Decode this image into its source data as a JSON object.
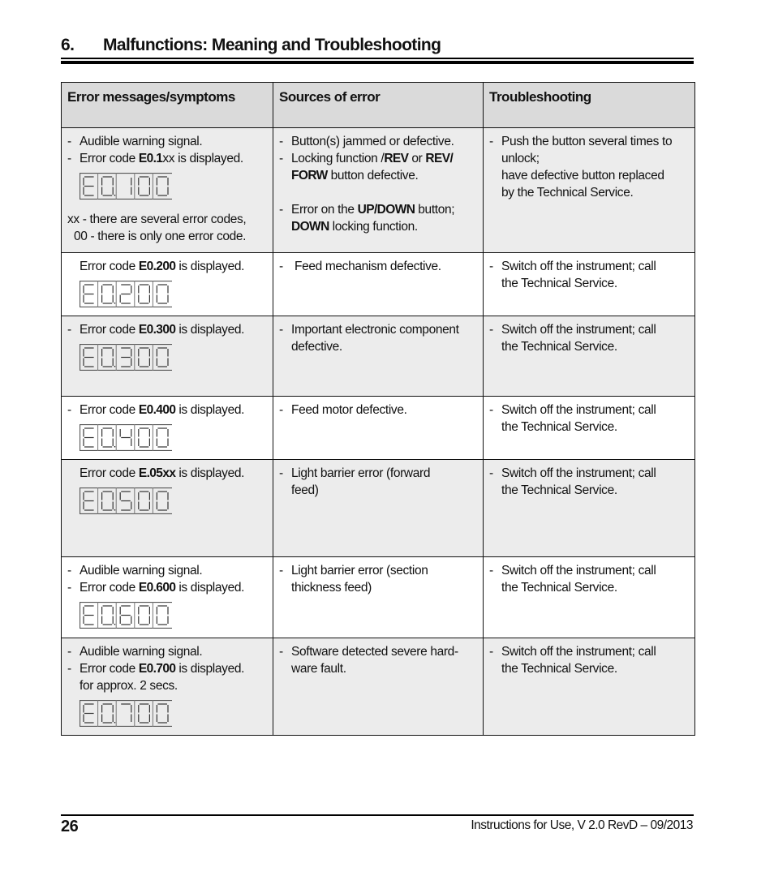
{
  "section": {
    "number": "6.",
    "title": "Malfunctions: Meaning and Troubleshooting"
  },
  "table": {
    "headers": [
      "Error messages/symptoms",
      "Sources of error",
      "Troubleshooting"
    ],
    "rows": [
      {
        "shade": "gray",
        "symptoms": [
          {
            "dash": true,
            "parts": [
              {
                "t": "Audible warning signal."
              }
            ]
          },
          {
            "dash": true,
            "parts": [
              {
                "t": "Error code "
              },
              {
                "t": "E0.1",
                "b": true
              },
              {
                "t": "xx is displayed."
              }
            ]
          }
        ],
        "display": {
          "digits": [
            "E",
            "0",
            "1",
            "0",
            "0"
          ],
          "dot_after": 1
        },
        "notes": [
          {
            "dash": false,
            "indent": false,
            "parts": [
              {
                "t": "xx - there are several error codes,"
              }
            ]
          },
          {
            "dash": false,
            "indent": "small",
            "parts": [
              {
                "t": "00 - there is only one error code."
              }
            ]
          }
        ],
        "sources": [
          {
            "dash": true,
            "parts": [
              {
                "t": "Button(s) jammed or defective."
              }
            ]
          },
          {
            "dash": true,
            "parts": [
              {
                "t": "Locking function /"
              },
              {
                "t": "REV",
                "b": true
              },
              {
                "t": " or "
              },
              {
                "t": "REV/",
                "b": true
              }
            ]
          },
          {
            "dash": false,
            "indent": true,
            "parts": [
              {
                "t": "FORW",
                "b": true
              },
              {
                "t": " button defective."
              }
            ]
          },
          {
            "gap": true
          },
          {
            "dash": true,
            "parts": [
              {
                "t": "Error on the "
              },
              {
                "t": "UP/DOWN",
                "b": true
              },
              {
                "t": " button;"
              }
            ]
          },
          {
            "dash": false,
            "indent": true,
            "parts": [
              {
                "t": "DOWN",
                "b": true
              },
              {
                "t": " locking function."
              }
            ]
          }
        ],
        "troubleshooting": [
          {
            "dash": true,
            "parts": [
              {
                "t": "Push the button several times to"
              }
            ]
          },
          {
            "dash": false,
            "indent": true,
            "parts": [
              {
                "t": "unlock;"
              }
            ]
          },
          {
            "dash": false,
            "indent": true,
            "parts": [
              {
                "t": "have defective button replaced"
              }
            ]
          },
          {
            "dash": false,
            "indent": true,
            "parts": [
              {
                "t": "by the Technical Service."
              }
            ]
          }
        ]
      },
      {
        "shade": "white",
        "symptoms": [
          {
            "dash": false,
            "indent": true,
            "parts": [
              {
                "t": "Error code "
              },
              {
                "t": "E0.200",
                "b": true
              },
              {
                "t": " is displayed."
              }
            ]
          }
        ],
        "display": {
          "digits": [
            "E",
            "0",
            "2",
            "0",
            "0"
          ],
          "dot_after": 1
        },
        "notes": [],
        "sources": [
          {
            "dash": true,
            "parts": [
              {
                "t": " Feed mechanism defective."
              }
            ]
          }
        ],
        "troubleshooting": [
          {
            "dash": true,
            "parts": [
              {
                "t": "Switch off the instrument; call"
              }
            ]
          },
          {
            "dash": false,
            "indent": true,
            "parts": [
              {
                "t": "the Technical Service."
              }
            ]
          }
        ]
      },
      {
        "shade": "gray",
        "symptoms": [
          {
            "dash": true,
            "parts": [
              {
                "t": "Error code "
              },
              {
                "t": "E0.300",
                "b": true
              },
              {
                "t": " is displayed."
              }
            ]
          }
        ],
        "display": {
          "digits": [
            "E",
            "0",
            "3",
            "0",
            "0"
          ],
          "dot_after": 1
        },
        "notes": [],
        "sources": [
          {
            "dash": true,
            "parts": [
              {
                "t": "Important electronic component"
              }
            ]
          },
          {
            "dash": false,
            "indent": true,
            "parts": [
              {
                "t": "defective."
              }
            ]
          }
        ],
        "troubleshooting": [
          {
            "dash": true,
            "parts": [
              {
                "t": "Switch off the instrument; call"
              }
            ]
          },
          {
            "dash": false,
            "indent": true,
            "parts": [
              {
                "t": "the Technical Service."
              }
            ]
          }
        ]
      },
      {
        "shade": "white",
        "symptoms": [
          {
            "dash": true,
            "parts": [
              {
                "t": "Error code "
              },
              {
                "t": "E0.400",
                "b": true
              },
              {
                "t": " is displayed."
              }
            ]
          }
        ],
        "display": {
          "digits": [
            "E",
            "0",
            "4",
            "0",
            "0"
          ],
          "dot_after": 1
        },
        "notes": [],
        "sources": [
          {
            "dash": true,
            "parts": [
              {
                "t": "Feed motor defective."
              }
            ]
          }
        ],
        "troubleshooting": [
          {
            "dash": true,
            "parts": [
              {
                "t": "Switch off the instrument; call"
              }
            ]
          },
          {
            "dash": false,
            "indent": true,
            "parts": [
              {
                "t": "the Technical Service."
              }
            ]
          }
        ]
      },
      {
        "shade": "gray",
        "symptoms": [
          {
            "dash": false,
            "indent": true,
            "parts": [
              {
                "t": "Error code "
              },
              {
                "t": "E.05xx",
                "b": true
              },
              {
                "t": " is displayed."
              }
            ]
          }
        ],
        "display": {
          "digits": [
            "E",
            "0",
            "5",
            "0",
            "0"
          ],
          "dot_after": 1
        },
        "notes": [],
        "sources": [
          {
            "dash": true,
            "parts": [
              {
                "t": "Light barrier error (forward"
              }
            ]
          },
          {
            "dash": false,
            "indent": true,
            "parts": [
              {
                "t": "feed)"
              }
            ]
          }
        ],
        "troubleshooting": [
          {
            "dash": true,
            "parts": [
              {
                "t": "Switch off the instrument; call"
              }
            ]
          },
          {
            "dash": false,
            "indent": true,
            "parts": [
              {
                "t": "the Technical Service."
              }
            ]
          }
        ]
      },
      {
        "shade": "white",
        "symptoms": [
          {
            "dash": true,
            "parts": [
              {
                "t": "Audible warning signal."
              }
            ]
          },
          {
            "dash": true,
            "parts": [
              {
                "t": "Error code "
              },
              {
                "t": "E0.600",
                "b": true
              },
              {
                "t": " is displayed."
              }
            ]
          }
        ],
        "display": {
          "digits": [
            "E",
            "0",
            "6",
            "0",
            "0"
          ],
          "dot_after": 1
        },
        "notes": [],
        "sources": [
          {
            "dash": true,
            "parts": [
              {
                "t": "Light barrier error (section"
              }
            ]
          },
          {
            "dash": false,
            "indent": true,
            "parts": [
              {
                "t": "thickness feed)"
              }
            ]
          }
        ],
        "troubleshooting": [
          {
            "dash": true,
            "parts": [
              {
                "t": "Switch off the instrument; call"
              }
            ]
          },
          {
            "dash": false,
            "indent": true,
            "parts": [
              {
                "t": "the Technical Service."
              }
            ]
          }
        ]
      },
      {
        "shade": "gray",
        "symptoms": [
          {
            "dash": true,
            "parts": [
              {
                "t": "Audible warning signal."
              }
            ]
          },
          {
            "dash": true,
            "parts": [
              {
                "t": "Error code "
              },
              {
                "t": "E0.700",
                "b": true
              },
              {
                "t": " is displayed."
              }
            ]
          },
          {
            "dash": false,
            "indent": true,
            "parts": [
              {
                "t": "for approx. 2 secs."
              }
            ]
          }
        ],
        "display": {
          "digits": [
            "E",
            "0",
            "7",
            "0",
            "0"
          ],
          "dot_after": 1
        },
        "notes": [],
        "sources": [
          {
            "dash": true,
            "parts": [
              {
                "t": "Software detected severe hard-"
              }
            ]
          },
          {
            "dash": false,
            "indent": true,
            "parts": [
              {
                "t": "ware fault."
              }
            ]
          }
        ],
        "troubleshooting": [
          {
            "dash": true,
            "parts": [
              {
                "t": "Switch off the instrument; call"
              }
            ]
          },
          {
            "dash": false,
            "indent": true,
            "parts": [
              {
                "t": "the Technical Service."
              }
            ]
          }
        ]
      }
    ]
  },
  "footer": {
    "page_number": "26",
    "text": "Instructions for Use, V 2.0 RevD – 09/2013"
  },
  "colors": {
    "header_bg": "#dadada",
    "row_gray_bg": "#ececec",
    "row_white_bg": "#ffffff",
    "segment": "#333333"
  }
}
